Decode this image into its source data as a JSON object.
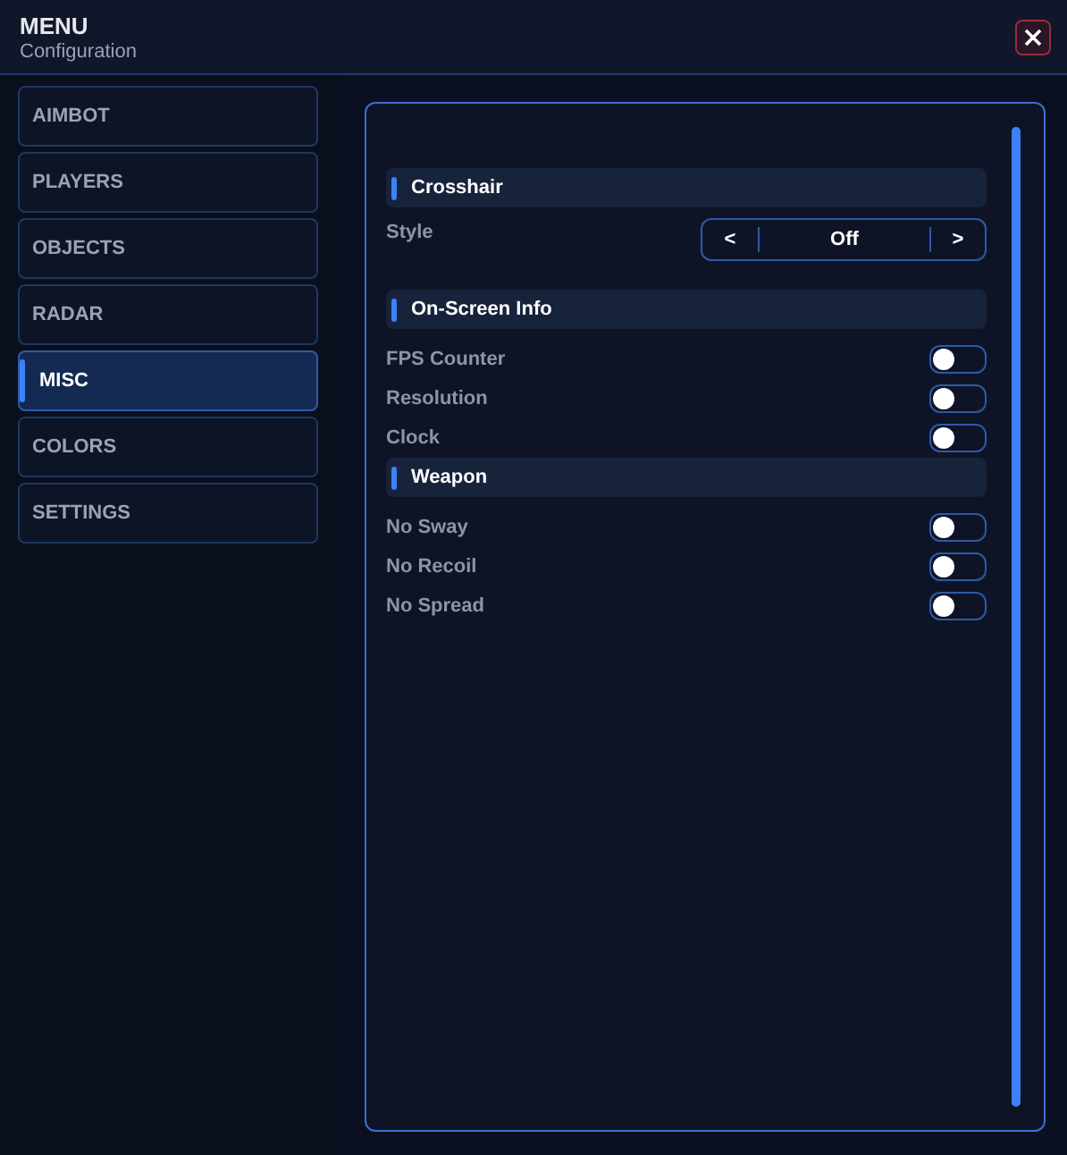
{
  "header": {
    "title": "MENU",
    "subtitle": "Configuration"
  },
  "sidebar": {
    "items": [
      {
        "label": "AIMBOT",
        "selected": false
      },
      {
        "label": "PLAYERS",
        "selected": false
      },
      {
        "label": "OBJECTS",
        "selected": false
      },
      {
        "label": "RADAR",
        "selected": false
      },
      {
        "label": "MISC",
        "selected": true
      },
      {
        "label": "COLORS",
        "selected": false
      },
      {
        "label": "SETTINGS",
        "selected": false
      }
    ]
  },
  "panel": {
    "rows": [
      {
        "kind": "header",
        "label": "Crosshair"
      },
      {
        "kind": "selector",
        "label": "Style",
        "prev": "<",
        "value": "Off",
        "next": ">"
      },
      {
        "kind": "header",
        "label": "On-Screen Info"
      },
      {
        "kind": "toggle",
        "label": "FPS Counter",
        "on": false
      },
      {
        "kind": "toggle",
        "label": "Resolution",
        "on": false
      },
      {
        "kind": "toggle",
        "label": "Clock",
        "on": false
      },
      {
        "kind": "header",
        "label": "Weapon"
      },
      {
        "kind": "toggle",
        "label": "No Sway",
        "on": false
      },
      {
        "kind": "toggle",
        "label": "No Recoil",
        "on": false
      },
      {
        "kind": "toggle",
        "label": "No Spread",
        "on": false
      }
    ]
  }
}
